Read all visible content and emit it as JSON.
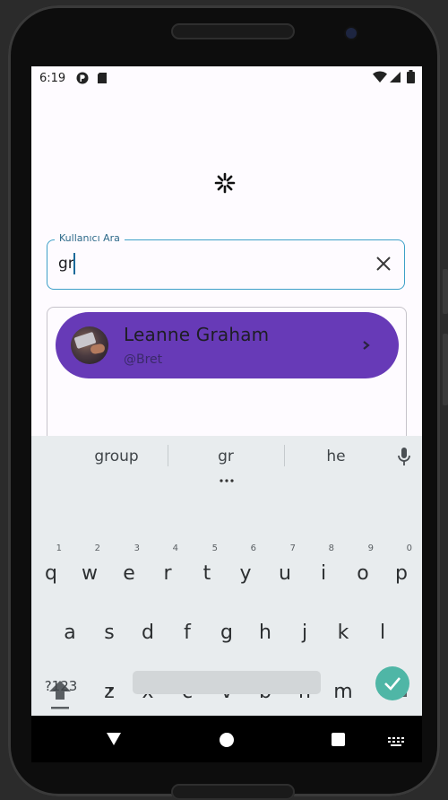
{
  "status_bar": {
    "time": "6:19"
  },
  "search": {
    "label": "Kullanıcı Ara",
    "value": "gr"
  },
  "results": [
    {
      "name": "Leanne Graham",
      "username": "@Bret"
    }
  ],
  "keyboard": {
    "suggestions": [
      "group",
      "gr",
      "he"
    ],
    "row1": [
      {
        "k": "q",
        "n": "1"
      },
      {
        "k": "w",
        "n": "2"
      },
      {
        "k": "e",
        "n": "3"
      },
      {
        "k": "r",
        "n": "4"
      },
      {
        "k": "t",
        "n": "5"
      },
      {
        "k": "y",
        "n": "6"
      },
      {
        "k": "u",
        "n": "7"
      },
      {
        "k": "i",
        "n": "8"
      },
      {
        "k": "o",
        "n": "9"
      },
      {
        "k": "p",
        "n": "0"
      }
    ],
    "row2": [
      "a",
      "s",
      "d",
      "f",
      "g",
      "h",
      "j",
      "k",
      "l"
    ],
    "row3": [
      "z",
      "x",
      "c",
      "v",
      "b",
      "n",
      "m"
    ],
    "symbols_key": "?123",
    "comma_key": ",",
    "period_key": "."
  },
  "colors": {
    "accent": "#673ab7",
    "field_border": "#3ea0c8",
    "enter_key": "#4fb6a6"
  },
  "icons": [
    "signal-icon",
    "wifi-icon",
    "battery-icon",
    "clear-icon",
    "chevron-right-icon",
    "mic-icon",
    "shift-icon",
    "backspace-icon",
    "check-icon",
    "back-icon",
    "home-icon",
    "recents-icon",
    "keyboard-icon",
    "loading-spinner-icon"
  ]
}
